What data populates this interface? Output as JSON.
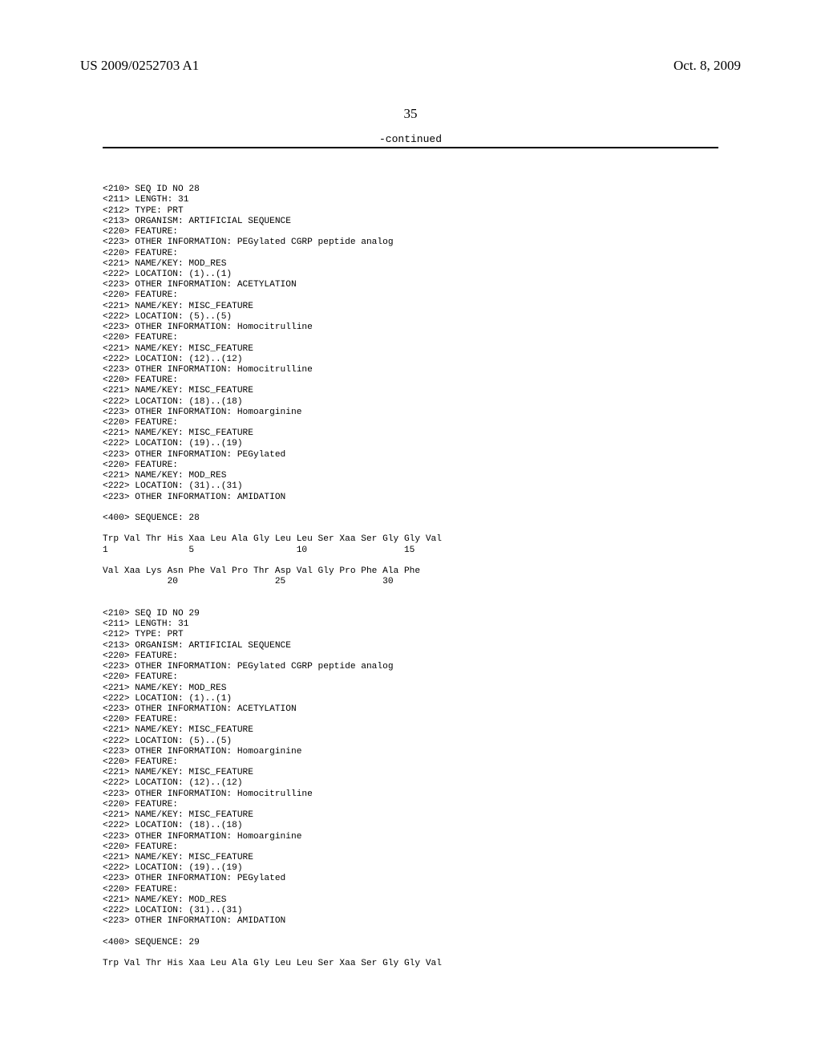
{
  "header": {
    "pub_number": "US 2009/0252703 A1",
    "pub_date": "Oct. 8, 2009"
  },
  "page_number": "35",
  "continued": "-continued",
  "seq28": {
    "l01": "<210> SEQ ID NO 28",
    "l02": "<211> LENGTH: 31",
    "l03": "<212> TYPE: PRT",
    "l04": "<213> ORGANISM: ARTIFICIAL SEQUENCE",
    "l05": "<220> FEATURE:",
    "l06": "<223> OTHER INFORMATION: PEGylated CGRP peptide analog",
    "l07": "<220> FEATURE:",
    "l08": "<221> NAME/KEY: MOD_RES",
    "l09": "<222> LOCATION: (1)..(1)",
    "l10": "<223> OTHER INFORMATION: ACETYLATION",
    "l11": "<220> FEATURE:",
    "l12": "<221> NAME/KEY: MISC_FEATURE",
    "l13": "<222> LOCATION: (5)..(5)",
    "l14": "<223> OTHER INFORMATION: Homocitrulline",
    "l15": "<220> FEATURE:",
    "l16": "<221> NAME/KEY: MISC_FEATURE",
    "l17": "<222> LOCATION: (12)..(12)",
    "l18": "<223> OTHER INFORMATION: Homocitrulline",
    "l19": "<220> FEATURE:",
    "l20": "<221> NAME/KEY: MISC_FEATURE",
    "l21": "<222> LOCATION: (18)..(18)",
    "l22": "<223> OTHER INFORMATION: Homoarginine",
    "l23": "<220> FEATURE:",
    "l24": "<221> NAME/KEY: MISC_FEATURE",
    "l25": "<222> LOCATION: (19)..(19)",
    "l26": "<223> OTHER INFORMATION: PEGylated",
    "l27": "<220> FEATURE:",
    "l28": "<221> NAME/KEY: MOD_RES",
    "l29": "<222> LOCATION: (31)..(31)",
    "l30": "<223> OTHER INFORMATION: AMIDATION",
    "l31": " ",
    "l32": "<400> SEQUENCE: 28",
    "l33": " ",
    "l34": "Trp Val Thr His Xaa Leu Ala Gly Leu Leu Ser Xaa Ser Gly Gly Val",
    "l35": "1               5                   10                  15",
    "l36": " ",
    "l37": "Val Xaa Lys Asn Phe Val Pro Thr Asp Val Gly Pro Phe Ala Phe",
    "l38": "            20                  25                  30"
  },
  "seq29": {
    "l01": "<210> SEQ ID NO 29",
    "l02": "<211> LENGTH: 31",
    "l03": "<212> TYPE: PRT",
    "l04": "<213> ORGANISM: ARTIFICIAL SEQUENCE",
    "l05": "<220> FEATURE:",
    "l06": "<223> OTHER INFORMATION: PEGylated CGRP peptide analog",
    "l07": "<220> FEATURE:",
    "l08": "<221> NAME/KEY: MOD_RES",
    "l09": "<222> LOCATION: (1)..(1)",
    "l10": "<223> OTHER INFORMATION: ACETYLATION",
    "l11": "<220> FEATURE:",
    "l12": "<221> NAME/KEY: MISC_FEATURE",
    "l13": "<222> LOCATION: (5)..(5)",
    "l14": "<223> OTHER INFORMATION: Homoarginine",
    "l15": "<220> FEATURE:",
    "l16": "<221> NAME/KEY: MISC_FEATURE",
    "l17": "<222> LOCATION: (12)..(12)",
    "l18": "<223> OTHER INFORMATION: Homocitrulline",
    "l19": "<220> FEATURE:",
    "l20": "<221> NAME/KEY: MISC_FEATURE",
    "l21": "<222> LOCATION: (18)..(18)",
    "l22": "<223> OTHER INFORMATION: Homoarginine",
    "l23": "<220> FEATURE:",
    "l24": "<221> NAME/KEY: MISC_FEATURE",
    "l25": "<222> LOCATION: (19)..(19)",
    "l26": "<223> OTHER INFORMATION: PEGylated",
    "l27": "<220> FEATURE:",
    "l28": "<221> NAME/KEY: MOD_RES",
    "l29": "<222> LOCATION: (31)..(31)",
    "l30": "<223> OTHER INFORMATION: AMIDATION",
    "l31": " ",
    "l32": "<400> SEQUENCE: 29",
    "l33": " ",
    "l34": "Trp Val Thr His Xaa Leu Ala Gly Leu Leu Ser Xaa Ser Gly Gly Val"
  }
}
